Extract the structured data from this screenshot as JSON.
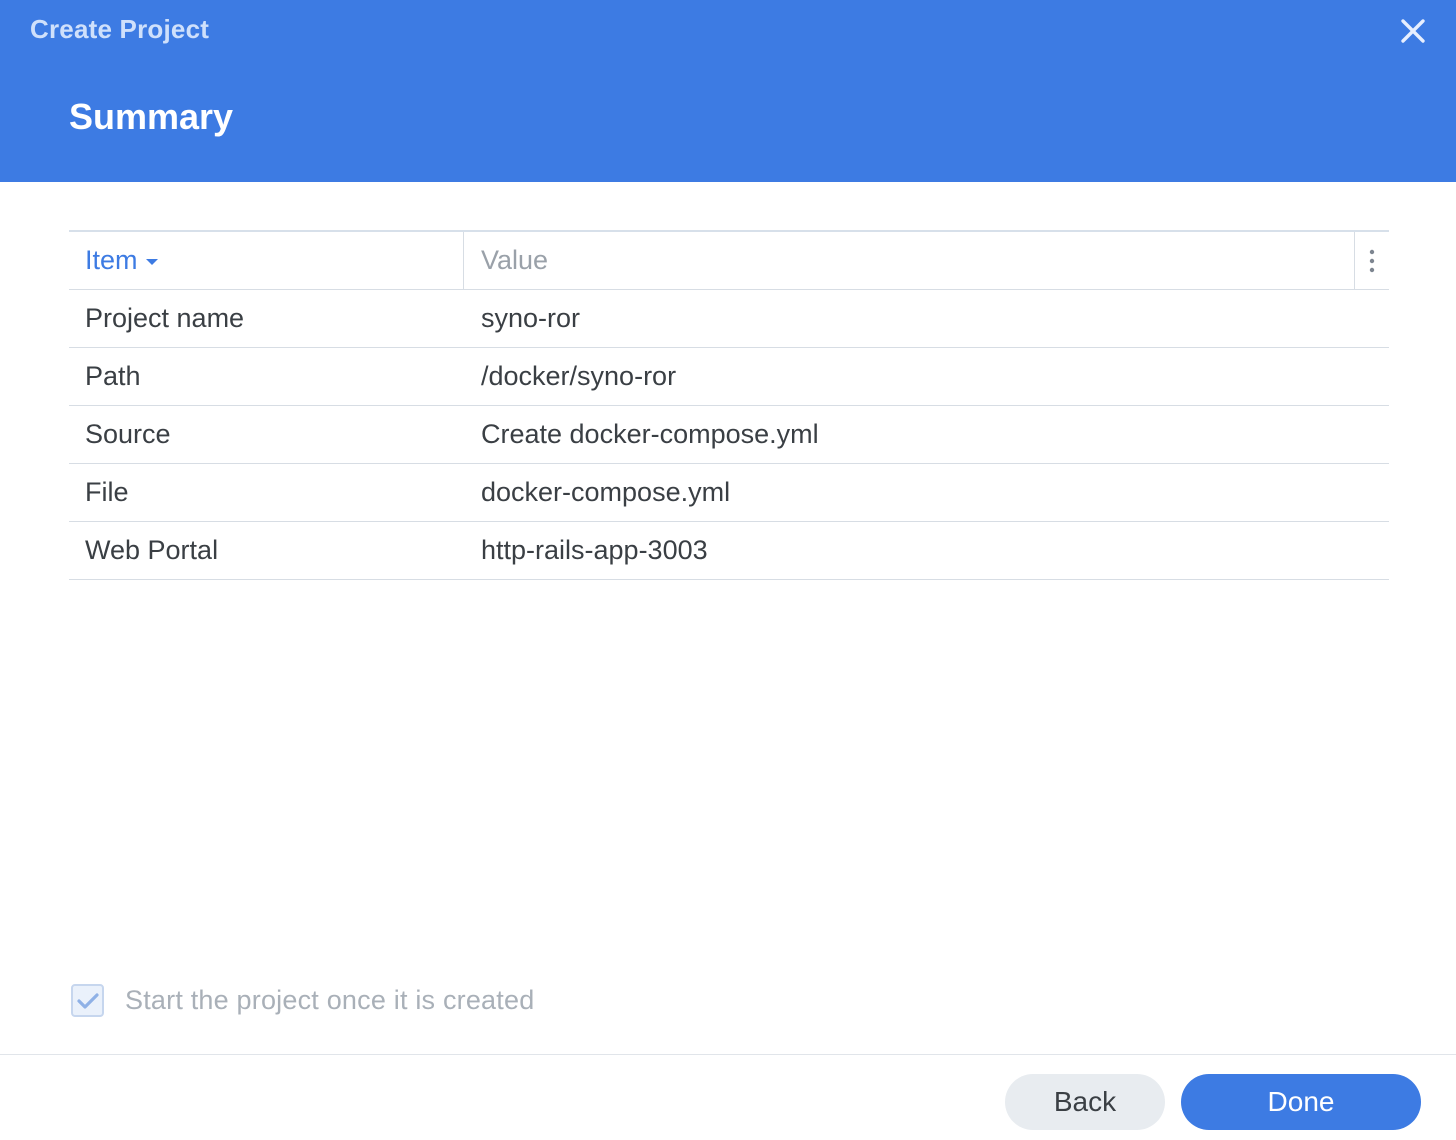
{
  "window": {
    "title": "Create Project",
    "close_icon": "close-icon"
  },
  "step": {
    "title": "Summary"
  },
  "table": {
    "columns": [
      {
        "label": "Item",
        "sorted": "descending"
      },
      {
        "label": "Value"
      }
    ],
    "rows": [
      {
        "item": "Project name",
        "value": "syno-ror"
      },
      {
        "item": "Path",
        "value": "/docker/syno-ror"
      },
      {
        "item": "Source",
        "value": "Create docker-compose.yml"
      },
      {
        "item": "File",
        "value": "docker-compose.yml"
      },
      {
        "item": "Web Portal",
        "value": "http-rails-app-3003"
      }
    ]
  },
  "start_option": {
    "label": "Start the project once it is created",
    "checked": true,
    "disabled": true
  },
  "footer": {
    "back_label": "Back",
    "done_label": "Done"
  },
  "colors": {
    "accent": "#3d7be3",
    "header_bg": "#3d7be3",
    "text": "#3a3f44",
    "muted": "#9aa1a9"
  }
}
